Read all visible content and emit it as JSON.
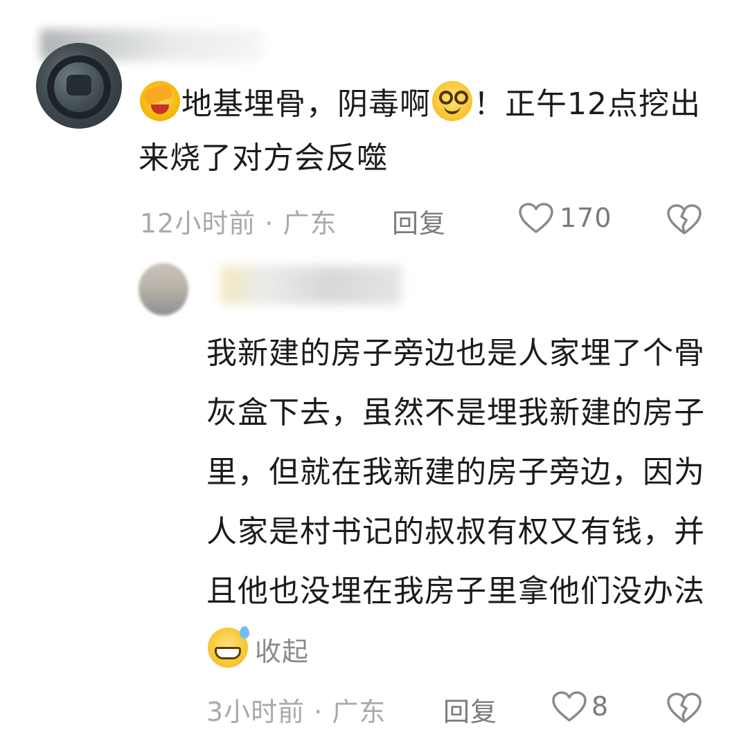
{
  "comments": [
    {
      "body_part1": "地基埋骨，阴毒啊",
      "body_part2": "！正午12点挖出来烧了对方会反噬",
      "emojis": [
        "facepalm-emoji",
        "smile-emoji"
      ],
      "time_location": "12小时前 · 广东",
      "reply_label": "回复",
      "like_count": "170"
    },
    {
      "body": "我新建的房子旁边也是人家埋了个骨灰盒下去，虽然不是埋我新建的房子里，但就在我新建的房子旁边，因为人家是村书记的叔叔有权又有钱，并且他也没埋在我房子里拿他们没办法",
      "emojis": [
        "sweat-grin-emoji"
      ],
      "collapse_label": "收起",
      "time_location": "3小时前 · 广东",
      "reply_label": "回复",
      "like_count": "8"
    }
  ],
  "icons": {
    "like": "heart-outline-icon",
    "dislike": "broken-heart-icon"
  },
  "colors": {
    "text": "#1b1b1b",
    "meta": "#a9a9a9",
    "action": "#7b7b7b"
  }
}
